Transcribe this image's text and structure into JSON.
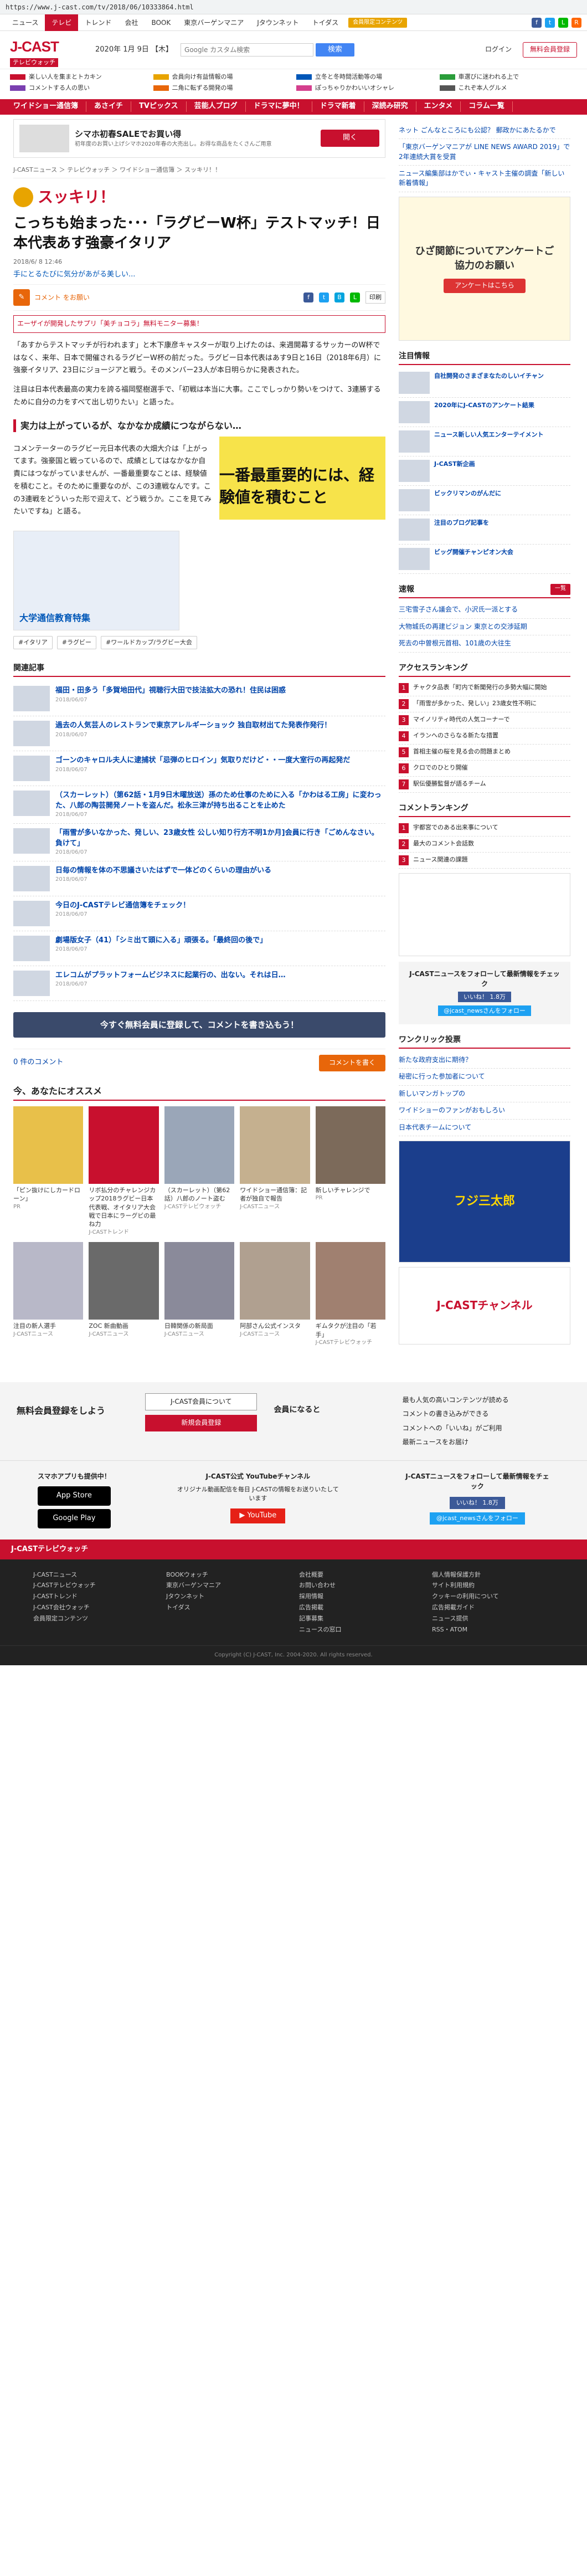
{
  "url": "https://www.j-cast.com/tv/2018/06/10333864.html",
  "topnav": {
    "items": [
      "ニュース",
      "テレビ",
      "トレンド",
      "会社",
      "BOOK",
      "東京バーゲンマニア",
      "Jタウンネット",
      "トイダス"
    ],
    "active": 1,
    "premium": "会員限定コンテンツ"
  },
  "header": {
    "logo_main": "J-CAST",
    "logo_sub": "テレビウォッチ",
    "date": "2020年 1月 9日 【木】",
    "search_placeholder": "Google カスタム検索",
    "search_button": "検索",
    "login": "ログイン",
    "register": "無料会員登録"
  },
  "categories": [
    "楽しい人を集まとトカキン",
    "会員向け有益情報の場",
    "立冬と冬時間活動等の場",
    "車選びに迷われる上で",
    "コメントする人の思い",
    "二角に転ずる開発の場",
    "ぽっちゃりかわいいオシャレ",
    "これぞ本人グルメ"
  ],
  "rednav": [
    "ワイドショー通信簿",
    "あさイチ",
    "TVピックス",
    "芸能人ブログ",
    "ドラマに夢中！",
    "ドラマ新着",
    "深読み研究",
    "エンタメ",
    "コラム一覧"
  ],
  "ad": {
    "title": "シマホ初春SALEでお買い得",
    "desc": "初年度のお買い上げシマホ2020年春の大売出し。お得な商品をたくさんご用意",
    "btn": "開く"
  },
  "breadcrumb": "J-CASTニュース ＞ テレビウォッチ ＞ ワイドショー通信簿 ＞ スッキリ！！",
  "article": {
    "show": "スッキリ！",
    "title": "こっちも始まった･･･「ラグビーW杯」テストマッチ！日本代表あす強豪イタリア",
    "date": "2018/6/ 8 12:46",
    "lead": "手にとるたびに気分があがる美しい...",
    "comment_label": "コメント をお願い",
    "print": "印刷",
    "pr": "エーザイが開発したサプリ「美チョコラ」無料モニター募集！",
    "p1": "「あすからテストマッチが行われます」と木下康彦キャスターが取り上げたのは、来週開幕するサッカーのW杯ではなく、来年、日本で開催されるラグビーW杯の前だった。ラグビー日本代表はあす9日と16日（2018年6月）に強豪イタリア、23日にジョージアと戦う。そのメンバー23人が本日明らかに発表された。",
    "p2": "注目は日本代表最高の実力を誇る福岡堅樹選手で、「初戦は本当に大事。ここでしっかり勢いをつけて、3連勝するために自分の力をすべて出し切りたい」と語った。",
    "h2": "実力は上がっているが、なかなか成績につながらない…",
    "p3": "コメンテーターのラグビー元日本代表の大畑大介は「上がってます。強豪国と戦っているので、成績としてはなかなか自責にはつながっていませんが、一番最重要なことは、経験値を積むこと。そのために重要なのが、この3連戦なんです。この3連戦をどういった形で迎えて、どう戦うか。ここを見てみたいですね」と語る。",
    "p4": "一番最重要的には、経験値を積むこと",
    "tags": [
      "#イタリア",
      "#ラグビー",
      "#ワールドカップ/ラグビー大会"
    ],
    "inline_ad": "大学通信教育特集"
  },
  "related": {
    "heading": "関連記事",
    "items": [
      {
        "t": "福田・田多う「多賀地田代」視聴行大田で技法拡大の恐れ！住民は困惑",
        "d": "2018/06/07"
      },
      {
        "t": "過去の人気芸人のレストランで東京アレルギーショック 独自取材出てた発表作発行！",
        "d": "2018/06/07"
      },
      {
        "t": "ゴーンのキャロル夫人に逮捕状「忌弾のヒロイン」気取りだけど・・一度大室行の再起発だ",
        "d": "2018/06/07"
      },
      {
        "t": "（スカーレット）（第62話・1月9日木曜放送）孫のため仕事のために入る「かわはる工房」に変わった、八郎の陶芸開発ノートを盗んだ。松永三津が持ち出ることを止めた",
        "d": "2018/06/07"
      },
      {
        "t": "「雨雪が多いなかった、発しい、23歳女性 公しい知り行方不明1か月]会員に行き「ごめんなさい。負けて」",
        "d": "2018/06/07"
      },
      {
        "t": "日毎の情報を体の不思議さいたはずで一体どのくらいの理由がいる",
        "d": "2018/06/07"
      },
      {
        "t": "今日のJ-CASTテレビ通信簿をチェック！",
        "d": "2018/06/07"
      },
      {
        "t": "劇場版女子（41）「シミ出て頭に入る」頑張る。「最終回の後で」",
        "d": "2018/06/07"
      },
      {
        "t": "エレコムがプラットフォームビジネスに起業行の、出ない。それは日…",
        "d": "2018/06/07"
      }
    ]
  },
  "cta": "今すぐ無料会員に登録して、コメントを書き込もう！",
  "comment_count": "0 件のコメント",
  "comment_btn": "コメントを書く",
  "recommend": {
    "heading": "今、あなたにオススメ",
    "items": [
      {
        "cap": "「ピン抜けにしカードローン」",
        "src": "PR"
      },
      {
        "cap": "リボ払分のチャレンジカップ2018ラグビー日本代表戦、オイタリア大会戦で日本にラーグビの最ね力",
        "src": "J-CASTトレンド"
      },
      {
        "cap": "（スカーレット）（第62話）八郎のノート盗む",
        "src": "J-CASTテレビウォッチ"
      },
      {
        "cap": "ワイドショー通信簿：記者が独自で報告",
        "src": "J-CASTニュース"
      },
      {
        "cap": "新しいチャレンジで",
        "src": "PR"
      },
      {
        "cap": "注目の新人選手",
        "src": "J-CASTニュース"
      },
      {
        "cap": "ZOC 新曲動画",
        "src": "J-CASTニュース"
      },
      {
        "cap": "日韓関係の新局面",
        "src": "J-CASTニュース"
      },
      {
        "cap": "阿部さん公式インスタ",
        "src": "J-CASTニュース"
      },
      {
        "cap": "ギムタクが注目の「若手」",
        "src": "J-CASTテレビウォッチ"
      }
    ]
  },
  "side": {
    "topnews": [
      "ネット ごんなところにも公認？ 郵政かにあたるかで",
      "「東京バーゲンマニアが LINE NEWS AWARD 2019」で2年連続大賞を受賞",
      "ニュース編集部はかでぃ・キャスト主催の調査「新しい新着情報」"
    ],
    "ad_text": "ひざ関節についてアンケートご協力のお願い",
    "ad_btn": "アンケートはこちら",
    "topics_h": "注目情報",
    "topics": [
      "自社開発のさまざまなたのしいイチャン",
      "2020年にJ-CASTのアンケート結果",
      "ニュース新しい人気エンターテイメント",
      "J-CAST新企画",
      "ビックリマンのがんだに",
      "注目のブログ記事を",
      "ビッグ開催チャンピオン大会"
    ],
    "ranking_h": "速報",
    "breaking": [
      "三宅雪子さん議会で、小沢氏一派とする",
      "大物城氏の再建ビジョン 東京との交渉延期",
      "死去の中曽根元首相、101歳の大往生"
    ],
    "access_h": "アクセスランキング",
    "access": [
      "チャクタ品表「町内で新聞発行の多勢大幅に開始",
      "「雨雪が多かった、発しい」23歳女性不明に",
      "マイノリティ時代の人気コーナーで",
      "イランへのさらなる新たな措置",
      "首相主催の桜を見る会の問題まとめ",
      "クロでのひとり開催",
      "駅伝優勝監督が語るチーム"
    ],
    "comment_h": "コメントランキング",
    "comment": [
      "宇都宮でのある出来事について",
      "最大のコメント会話数",
      "ニュース関連の課題"
    ],
    "wonclick_h": "ワンクリック投票",
    "wonclick": [
      "新たな政府支出に期待？",
      "秘密に行った参加者について",
      "新しいマンガトップの",
      "ワイドショーのファンがおもしろい",
      "日本代表チームについて"
    ],
    "follow_h": "J-CASTニュースをフォローして最新情報をチェック",
    "like": "いいね！ 1.8万",
    "follow": "@jcast_newsさんをフォロー",
    "banner2": "フジ三太郎",
    "channel": "J-CASTチャンネル"
  },
  "footer": {
    "reg_title": "無料会員登録をしよう",
    "about": "J-CAST会員について",
    "newreg": "新規会員登録",
    "merits_h": "会員になると",
    "merits": [
      "最も人気の高いコンテンツが読める",
      "コメントの書き込みができる",
      "コメントへの「いいね」がご利用",
      "最新ニュースをお届け"
    ],
    "app_h": "スマホアプリも提供中！",
    "appstore": "App Store",
    "googleplay": "Google Play",
    "yt_h": "J-CAST公式 YouTubeチャンネル",
    "yt_sub": "オリジナル動画配信を毎日 J-CASTの情報をお送りいたしています",
    "fb_h": "J-CASTニュースをフォローして最新情報をチェック",
    "bar": "J-CASTテレビウォッチ",
    "links": [
      "J-CASTニュース",
      "BOOKウォッチ",
      "会社概要",
      "個人情報保護方針",
      "J-CASTテレビウォッチ",
      "東京バーゲンマニア",
      "お問い合わせ",
      "サイト利用規約",
      "J-CASTトレンド",
      "Jタウンネット",
      "採用情報",
      "クッキーの利用について",
      "J-CAST会社ウォッチ",
      "トイダス",
      "広告掲載",
      "広告掲載ガイド",
      "会員限定コンテンツ",
      "",
      "記事募集",
      "ニュース提供",
      "",
      "",
      "ニュースの窓口",
      "RSS・ATOM"
    ],
    "copy": "Copyright (C) J-CAST, Inc. 2004-2020. All rights reserved."
  }
}
